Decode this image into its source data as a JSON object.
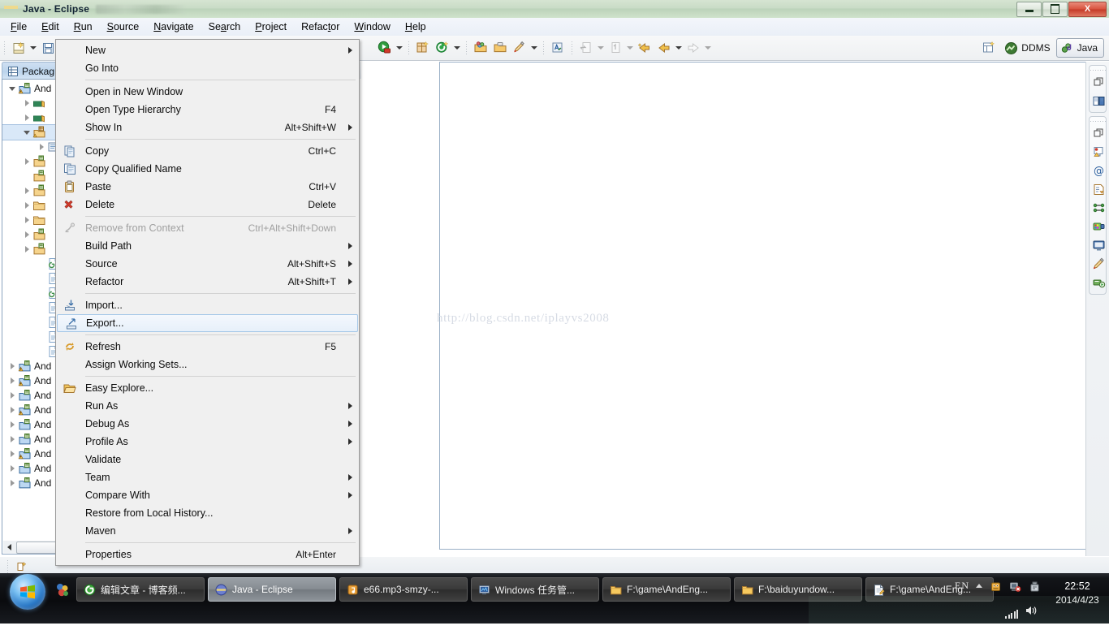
{
  "window": {
    "title": "Java - Eclipse",
    "minimize_label": "Minimize",
    "restore_label": "Restore",
    "close_label": "X"
  },
  "menubar": [
    {
      "label": "File",
      "mnemonic": "F"
    },
    {
      "label": "Edit",
      "mnemonic": "E"
    },
    {
      "label": "Run",
      "mnemonic": "R"
    },
    {
      "label": "Source",
      "mnemonic": "S"
    },
    {
      "label": "Navigate",
      "mnemonic": "N"
    },
    {
      "label": "Search",
      "mnemonic": "a"
    },
    {
      "label": "Project",
      "mnemonic": "P"
    },
    {
      "label": "Refactor",
      "mnemonic": "t"
    },
    {
      "label": "Window",
      "mnemonic": "W"
    },
    {
      "label": "Help",
      "mnemonic": "H"
    }
  ],
  "toolbar": {
    "perspective_java": "Java",
    "ddms": "DDMS"
  },
  "package_explorer": {
    "tab_label": "Packag",
    "tab_full_label": "Package Explorer",
    "tree_rows": [
      {
        "label": "And",
        "indent": 0,
        "arrow": "open",
        "icon": "project-warning-icon"
      },
      {
        "label": "",
        "indent": 1,
        "arrow": "closed",
        "icon": "library-icon"
      },
      {
        "label": "",
        "indent": 1,
        "arrow": "closed",
        "icon": "library-icon"
      },
      {
        "label": "",
        "indent": 1,
        "arrow": "open",
        "icon": "source-folder-selected-icon",
        "selected": true
      },
      {
        "label": "",
        "indent": 2,
        "arrow": "closed",
        "icon": "package-icon"
      },
      {
        "label": "",
        "indent": 1,
        "arrow": "closed",
        "icon": "source-folder-icon"
      },
      {
        "label": "",
        "indent": 1,
        "arrow": "none",
        "icon": "source-folder-icon"
      },
      {
        "label": "",
        "indent": 1,
        "arrow": "closed",
        "icon": "source-folder-icon"
      },
      {
        "label": "",
        "indent": 1,
        "arrow": "closed",
        "icon": "folder-icon"
      },
      {
        "label": "",
        "indent": 1,
        "arrow": "closed",
        "icon": "folder-icon"
      },
      {
        "label": "",
        "indent": 1,
        "arrow": "closed",
        "icon": "source-folder-icon"
      },
      {
        "label": "",
        "indent": 1,
        "arrow": "closed",
        "icon": "source-folder-icon"
      },
      {
        "label": "",
        "indent": 2,
        "arrow": "none",
        "icon": "xml-file-icon"
      },
      {
        "label": "",
        "indent": 2,
        "arrow": "none",
        "icon": "text-file-icon"
      },
      {
        "label": "",
        "indent": 2,
        "arrow": "none",
        "icon": "xml-file-icon"
      },
      {
        "label": "",
        "indent": 2,
        "arrow": "none",
        "icon": "text-file-icon"
      },
      {
        "label": "",
        "indent": 2,
        "arrow": "none",
        "icon": "text-file-icon"
      },
      {
        "label": "",
        "indent": 2,
        "arrow": "none",
        "icon": "text-file-icon"
      },
      {
        "label": "",
        "indent": 2,
        "arrow": "none",
        "icon": "text-file-icon"
      },
      {
        "label": "And",
        "indent": 0,
        "arrow": "closed",
        "icon": "project-warning-icon"
      },
      {
        "label": "And",
        "indent": 0,
        "arrow": "closed",
        "icon": "project-warning-icon"
      },
      {
        "label": "And",
        "indent": 0,
        "arrow": "closed",
        "icon": "project-icon"
      },
      {
        "label": "And",
        "indent": 0,
        "arrow": "closed",
        "icon": "project-warning-icon"
      },
      {
        "label": "And",
        "indent": 0,
        "arrow": "closed",
        "icon": "project-icon"
      },
      {
        "label": "And",
        "indent": 0,
        "arrow": "closed",
        "icon": "project-icon"
      },
      {
        "label": "And",
        "indent": 0,
        "arrow": "closed",
        "icon": "project-warning-icon"
      },
      {
        "label": "And",
        "indent": 0,
        "arrow": "closed",
        "icon": "project-icon"
      },
      {
        "label": "And",
        "indent": 0,
        "arrow": "closed",
        "icon": "project-icon"
      }
    ]
  },
  "editor": {
    "watermark": "http://blog.csdn.net/iplayvs2008"
  },
  "context_menu": {
    "items": [
      {
        "label": "New",
        "accel": "",
        "submenu": true,
        "icon": "",
        "disabled": false
      },
      {
        "label": "Go Into",
        "accel": "",
        "submenu": false,
        "icon": "",
        "disabled": false
      },
      {
        "sep": true
      },
      {
        "label": "Open in New Window",
        "accel": "",
        "submenu": false,
        "icon": "",
        "disabled": false
      },
      {
        "label": "Open Type Hierarchy",
        "accel": "F4",
        "submenu": false,
        "icon": "",
        "disabled": false
      },
      {
        "label": "Show In",
        "accel": "Alt+Shift+W",
        "submenu": true,
        "icon": "",
        "disabled": false
      },
      {
        "sep": true
      },
      {
        "label": "Copy",
        "accel": "Ctrl+C",
        "submenu": false,
        "icon": "copy-icon",
        "disabled": false
      },
      {
        "label": "Copy Qualified Name",
        "accel": "",
        "submenu": false,
        "icon": "copy-qualified-icon",
        "disabled": false
      },
      {
        "label": "Paste",
        "accel": "Ctrl+V",
        "submenu": false,
        "icon": "paste-icon",
        "disabled": false
      },
      {
        "label": "Delete",
        "accel": "Delete",
        "submenu": false,
        "icon": "delete-icon",
        "disabled": false
      },
      {
        "sep": true
      },
      {
        "label": "Remove from Context",
        "accel": "Ctrl+Alt+Shift+Down",
        "submenu": false,
        "icon": "remove-context-icon",
        "disabled": true
      },
      {
        "label": "Build Path",
        "accel": "",
        "submenu": true,
        "icon": "",
        "disabled": false
      },
      {
        "label": "Source",
        "accel": "Alt+Shift+S",
        "submenu": true,
        "icon": "",
        "disabled": false
      },
      {
        "label": "Refactor",
        "accel": "Alt+Shift+T",
        "submenu": true,
        "icon": "",
        "disabled": false
      },
      {
        "sep": true
      },
      {
        "label": "Import...",
        "accel": "",
        "submenu": false,
        "icon": "import-icon",
        "disabled": false
      },
      {
        "label": "Export...",
        "accel": "",
        "submenu": false,
        "icon": "export-icon",
        "disabled": false,
        "highlighted": true
      },
      {
        "sep": true
      },
      {
        "label": "Refresh",
        "accel": "F5",
        "submenu": false,
        "icon": "refresh-icon",
        "disabled": false
      },
      {
        "label": "Assign Working Sets...",
        "accel": "",
        "submenu": false,
        "icon": "",
        "disabled": false
      },
      {
        "sep": true
      },
      {
        "label": "Easy Explore...",
        "accel": "",
        "submenu": false,
        "icon": "folder-open-icon",
        "disabled": false
      },
      {
        "label": "Run As",
        "accel": "",
        "submenu": true,
        "icon": "",
        "disabled": false
      },
      {
        "label": "Debug As",
        "accel": "",
        "submenu": true,
        "icon": "",
        "disabled": false
      },
      {
        "label": "Profile As",
        "accel": "",
        "submenu": true,
        "icon": "",
        "disabled": false
      },
      {
        "label": "Validate",
        "accel": "",
        "submenu": false,
        "icon": "",
        "disabled": false
      },
      {
        "label": "Team",
        "accel": "",
        "submenu": true,
        "icon": "",
        "disabled": false
      },
      {
        "label": "Compare With",
        "accel": "",
        "submenu": true,
        "icon": "",
        "disabled": false
      },
      {
        "label": "Restore from Local History...",
        "accel": "",
        "submenu": false,
        "icon": "",
        "disabled": false
      },
      {
        "label": "Maven",
        "accel": "",
        "submenu": true,
        "icon": "",
        "disabled": false
      },
      {
        "sep": true
      },
      {
        "label": "Properties",
        "accel": "Alt+Enter",
        "submenu": false,
        "icon": "",
        "disabled": false
      }
    ]
  },
  "taskbar": {
    "items": [
      {
        "label": "编辑文章 - 博客频...",
        "icon": "browser-icon",
        "active": false
      },
      {
        "label": "Java - Eclipse",
        "icon": "eclipse-icon",
        "active": true
      },
      {
        "label": "e66.mp3-smzy-...",
        "icon": "media-icon",
        "active": false
      },
      {
        "label": "Windows 任务管...",
        "icon": "taskmgr-icon",
        "active": false
      },
      {
        "label": "F:\\game\\AndEng...",
        "icon": "folder-icon",
        "active": false
      },
      {
        "label": "F:\\baiduyundow...",
        "icon": "folder-icon",
        "active": false
      },
      {
        "label": "F:\\game\\AndEng...",
        "icon": "notepad-icon",
        "active": false
      }
    ],
    "tray": {
      "language": "EN",
      "time": "22:52",
      "date": "2014/4/23"
    }
  },
  "colors": {
    "title_bg": "#c9dcc6",
    "menu_bg": "#f0f0f0",
    "highlight": "#a6c8e8",
    "tab_active": "#bcd4ec",
    "taskbar_bg": "#0a0b0e"
  }
}
